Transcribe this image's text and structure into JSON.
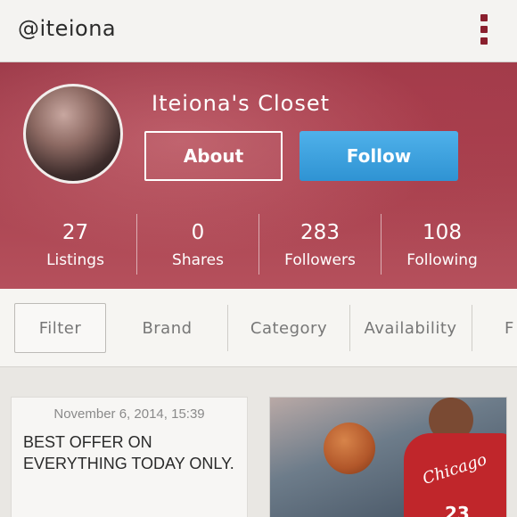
{
  "app": {
    "handle": "@iteiona"
  },
  "profile": {
    "closet_title": "Iteiona's Closet",
    "about_label": "About",
    "follow_label": "Follow",
    "stats": [
      {
        "value": "27",
        "label": "Listings"
      },
      {
        "value": "0",
        "label": "Shares"
      },
      {
        "value": "283",
        "label": "Followers"
      },
      {
        "value": "108",
        "label": "Following"
      }
    ]
  },
  "filters": {
    "items": [
      "Filter",
      "Brand",
      "Category",
      "Availability",
      "F"
    ]
  },
  "feed": {
    "post_date": "November 6, 2014, 15:39",
    "post_text": "BEST OFFER ON EVERYTHING TODAY ONLY.",
    "image_jersey_text": "Chicago",
    "image_jersey_number": "23"
  },
  "colors": {
    "menu": "#8a1f2e",
    "follow_button": "#3aa1de",
    "header_bg": "#a8424f"
  }
}
